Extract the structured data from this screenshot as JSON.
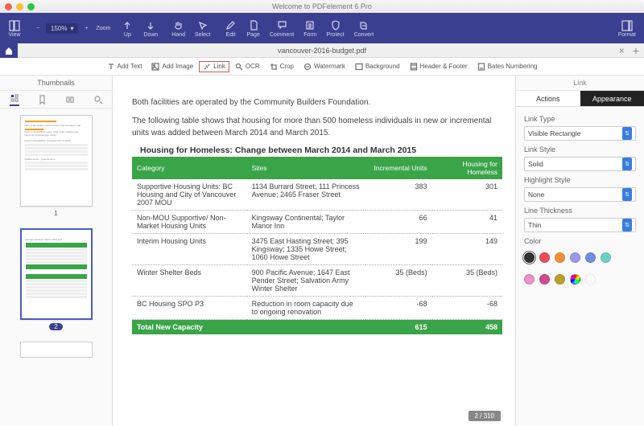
{
  "titlebar": {
    "title": "Welcome to PDFelement 6 Pro"
  },
  "toolbar": {
    "view": "View",
    "zoom": "Zoom",
    "zoom_value": "150%",
    "up": "Up",
    "down": "Down",
    "hand": "Hand",
    "select": "Select",
    "edit": "Edit",
    "page": "Page",
    "comment": "Comment",
    "form": "Form",
    "protect": "Protect",
    "convert": "Convert",
    "format": "Format"
  },
  "document_tab": {
    "name": "vancouver-2016-budget.pdf"
  },
  "subtoolbar": {
    "add_text": "Add Text",
    "add_image": "Add Image",
    "link": "Link",
    "ocr": "OCR",
    "crop": "Crop",
    "watermark": "Watermark",
    "background": "Background",
    "header_footer": "Header & Footer",
    "bates": "Bates Numbering"
  },
  "thumbnails": {
    "title": "Thumbnails",
    "page1_label": "1",
    "page2_label": "2"
  },
  "doc": {
    "para1": "Both facilities are operated by the Community Builders Foundation.",
    "para2": "The following table shows that housing for more than 500 homeless individuals in new or incremental units was added between March 2014 and March 2015.",
    "table_title": "Housing for Homeless: Change between March 2014 and March 2015",
    "table": {
      "headers": [
        "Category",
        "Sites",
        "Incremental Units",
        "Housing for Homeless"
      ],
      "rows": [
        {
          "category": "Supportive Housing Units: BC Housing and City of Vancouver 2007 MOU",
          "sites": "1134 Burrard Street; 111 Princess Avenue; 2465 Fraser Street",
          "inc": "383",
          "hfh": "301"
        },
        {
          "category": "Non-MOU Supportive/ Non-Market Housing Units",
          "sites": "Kingsway Continental; Taylor Manor Inn",
          "inc": "66",
          "hfh": "41"
        },
        {
          "category": "Interim Housing Units",
          "sites": "3475 East Hasting Street; 395 Kingsway; 1335 Howe Street; 1060 Howe Street",
          "inc": "199",
          "hfh": "149"
        },
        {
          "category": "Winter Shelter Beds",
          "sites": "900 Pacific Avenue; 1647 East Pender Street; Salvation Army Winter Shelter",
          "inc": "35 (Beds)",
          "hfh": "35 (Beds)"
        },
        {
          "category": "BC Housing SPO P3",
          "sites": "Reduction in room capacity due to ongoing renovation",
          "inc": "-68",
          "hfh": "-68"
        }
      ],
      "total": {
        "category": "Total New Capacity",
        "sites": "",
        "inc": "615",
        "hfh": "458"
      }
    },
    "page_indicator": "2 / 310"
  },
  "sidepanel": {
    "title": "Link",
    "tab_actions": "Actions",
    "tab_appearance": "Appearance",
    "link_type_label": "Link Type",
    "link_type_value": "Visible Rectangle",
    "link_style_label": "Link Style",
    "link_style_value": "Solid",
    "highlight_label": "Highlight Style",
    "highlight_value": "None",
    "thickness_label": "Line Thickness",
    "thickness_value": "Thin",
    "color_label": "Color"
  },
  "colors": {
    "row1": [
      "#333333",
      "#e94b57",
      "#f0903a",
      "#9a9ae8",
      "#6f8fe0",
      "#6dd0c9"
    ],
    "row2": [
      "#e893c5",
      "#d14a8e",
      "#b8a02b"
    ]
  },
  "chart_data": {
    "type": "table",
    "title": "Housing for Homeless: Change between March 2014 and March 2015",
    "columns": [
      "Category",
      "Sites",
      "Incremental Units",
      "Housing for Homeless"
    ],
    "rows": [
      [
        "Supportive Housing Units: BC Housing and City of Vancouver 2007 MOU",
        "1134 Burrard Street; 111 Princess Avenue; 2465 Fraser Street",
        383,
        301
      ],
      [
        "Non-MOU Supportive/ Non-Market Housing Units",
        "Kingsway Continental; Taylor Manor Inn",
        66,
        41
      ],
      [
        "Interim Housing Units",
        "3475 East Hasting Street; 395 Kingsway; 1335 Howe Street; 1060 Howe Street",
        199,
        149
      ],
      [
        "Winter Shelter Beds",
        "900 Pacific Avenue; 1647 East Pender Street; Salvation Army Winter Shelter",
        35,
        35
      ],
      [
        "BC Housing SPO P3",
        "Reduction in room capacity due to ongoing renovation",
        -68,
        -68
      ]
    ],
    "total": [
      "Total New Capacity",
      "",
      615,
      458
    ]
  }
}
